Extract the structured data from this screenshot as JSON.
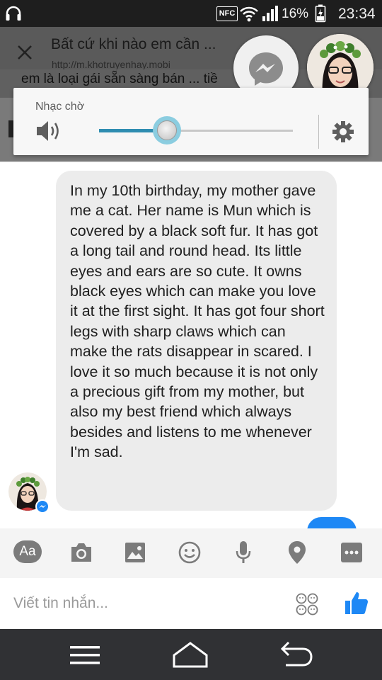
{
  "status_bar": {
    "nfc_label": "NFC",
    "battery_text": "16%",
    "time": "23:34"
  },
  "browser": {
    "title": "Bất cứ khi nào em cần ...",
    "url": "http://m.khotruyenhay.mobi",
    "page_text_peek": "em là loại gái sẵn sàng bán ... tiề"
  },
  "volume_panel": {
    "label": "Nhạc chờ",
    "level": 0.35
  },
  "chat": {
    "message": "In my 10th birthday, my mother gave me a cat. Her name is Mun which is covered by a black soft fur. It has got a long tail and round head. Its little eyes and ears are so cute. It owns black eyes which can make you love it at the first sight. It has got four short legs with sharp claws which can make the rats disappear in scared. I love it so much because it is not only a precious gift from my mother, but also my best friend which always besides and listens to me whenever I'm sad."
  },
  "composer": {
    "aa_label": "Aa",
    "placeholder": "Viết tin nhắn..."
  },
  "colors": {
    "messenger_blue": "#1e88f5",
    "volume_accent": "#3aa3c9"
  }
}
